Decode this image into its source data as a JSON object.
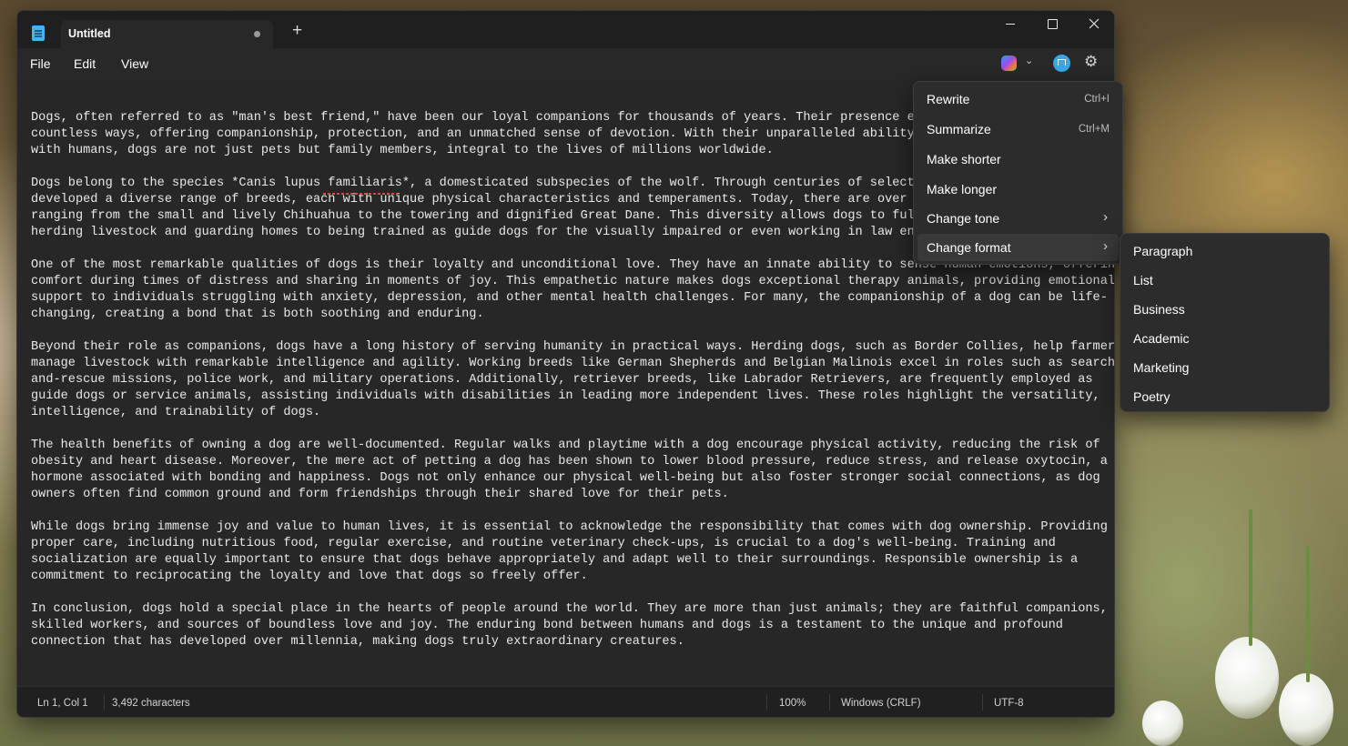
{
  "window": {
    "tab_title": "Untitled",
    "tab_add": "+",
    "controls": [
      "minimize",
      "maximize",
      "close"
    ]
  },
  "menu": {
    "file": "File",
    "edit": "Edit",
    "view": "View"
  },
  "toolbar_icons": [
    "copilot-icon",
    "chevron-down-icon",
    "rewrite-icon",
    "gear-icon"
  ],
  "editor": {
    "paragraphs": [
      "Dogs, often referred to as \"man's best friend,\" have been our loyal companions for thousands of years. Their presence enr\ncountless ways, offering companionship, protection, and an unmatched sense of devotion. With their unparalleled ability t\nwith humans, dogs are not just pets but family members, integral to the lives of millions worldwide.",
      "Dogs belong to the species *Canis lupus familiaris*, a domesticated subspecies of the wolf. Through centuries of selectiv\ndeveloped a diverse range of breeds, each with unique physical characteristics and temperaments. Today, there are over 30\nranging from the small and lively Chihuahua to the towering and dignified Great Dane. This diversity allows dogs to fulfi\nherding livestock and guarding homes to being trained as guide dogs for the visually impaired or even working in law enfo",
      "One of the most remarkable qualities of dogs is their loyalty and unconditional love. They have an innate ability to sense human emotions, offering\ncomfort during times of distress and sharing in moments of joy. This empathetic nature makes dogs exceptional therapy animals, providing emotional\nsupport to individuals struggling with anxiety, depression, and other mental health challenges. For many, the companionship of a dog can be life-\nchanging, creating a bond that is both soothing and enduring.",
      "Beyond their role as companions, dogs have a long history of serving humanity in practical ways. Herding dogs, such as Border Collies, help farmers\nmanage livestock with remarkable intelligence and agility. Working breeds like German Shepherds and Belgian Malinois excel in roles such as search-\nand-rescue missions, police work, and military operations. Additionally, retriever breeds, like Labrador Retrievers, are frequently employed as\nguide dogs or service animals, assisting individuals with disabilities in leading more independent lives. These roles highlight the versatility,\nintelligence, and trainability of dogs.",
      "The health benefits of owning a dog are well-documented. Regular walks and playtime with a dog encourage physical activity, reducing the risk of\nobesity and heart disease. Moreover, the mere act of petting a dog has been shown to lower blood pressure, reduce stress, and release oxytocin, a\nhormone associated with bonding and happiness. Dogs not only enhance our physical well-being but also foster stronger social connections, as dog\nowners often find common ground and form friendships through their shared love for their pets.",
      "While dogs bring immense joy and value to human lives, it is essential to acknowledge the responsibility that comes with dog ownership. Providing\nproper care, including nutritious food, regular exercise, and routine veterinary check-ups, is crucial to a dog's well-being. Training and\nsocialization are equally important to ensure that dogs behave appropriately and adapt well to their surroundings. Responsible ownership is a\ncommitment to reciprocating the loyalty and love that dogs so freely offer.",
      "In conclusion, dogs hold a special place in the hearts of people around the world. They are more than just animals; they are faithful companions,\nskilled workers, and sources of boundless love and joy. The enduring bond between humans and dogs is a testament to the unique and profound\nconnection that has developed over millennia, making dogs truly extraordinary creatures."
    ]
  },
  "status": {
    "position": "Ln 1, Col 1",
    "characters": "3,492 characters",
    "zoom": "100%",
    "line_ending": "Windows (CRLF)",
    "encoding": "UTF-8"
  },
  "context_menu": {
    "rewrite": "Rewrite",
    "rewrite_shortcut": "Ctrl+I",
    "summarize": "Summarize",
    "summarize_shortcut": "Ctrl+M",
    "make_shorter": "Make shorter",
    "make_longer": "Make longer",
    "change_tone": "Change tone",
    "change_format": "Change format",
    "arrow": "›"
  },
  "format_submenu": {
    "items": [
      "Paragraph",
      "List",
      "Business",
      "Academic",
      "Marketing",
      "Poetry"
    ]
  }
}
